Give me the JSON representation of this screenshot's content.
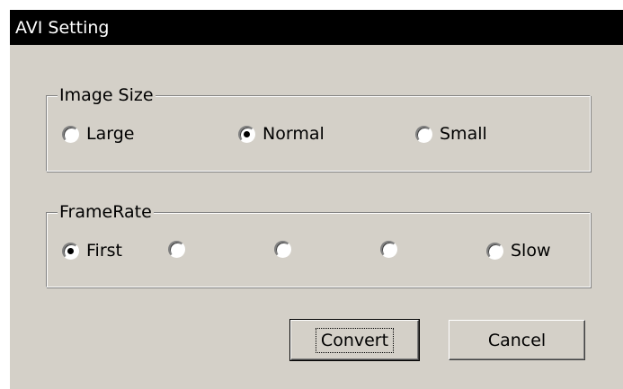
{
  "window": {
    "title": "AVI Setting"
  },
  "image_size": {
    "legend": "Image Size",
    "options": [
      {
        "label": "Large",
        "checked": false
      },
      {
        "label": "Normal",
        "checked": true
      },
      {
        "label": "Small",
        "checked": false
      }
    ]
  },
  "frame_rate": {
    "legend": "FrameRate",
    "options": [
      {
        "label": "First",
        "checked": true
      },
      {
        "label": "",
        "checked": false
      },
      {
        "label": "",
        "checked": false
      },
      {
        "label": "",
        "checked": false
      },
      {
        "label": "Slow",
        "checked": false
      }
    ]
  },
  "buttons": {
    "convert_label": "Convert",
    "cancel_label": "Cancel"
  },
  "colors": {
    "titlebar_bg": "#000000",
    "titlebar_text": "#ffffff",
    "dialog_bg": "#d4d0c8"
  }
}
